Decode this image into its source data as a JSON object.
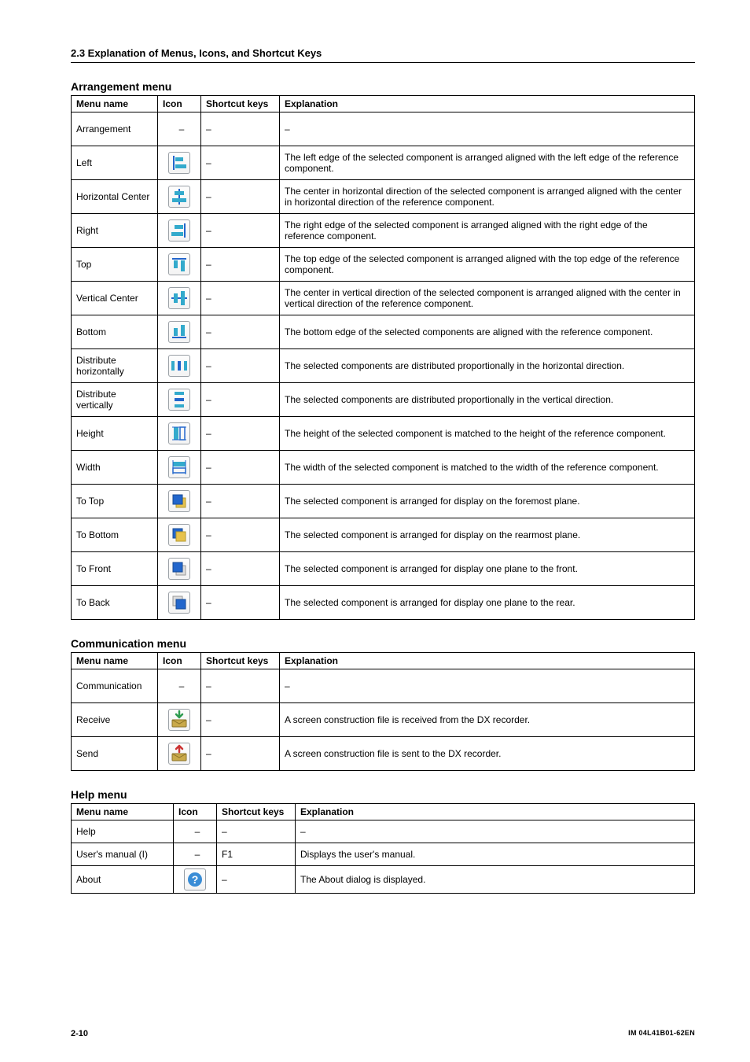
{
  "header": {
    "section": "2.3  Explanation of Menus, Icons, and Shortcut Keys"
  },
  "columns": {
    "name": "Menu name",
    "icon": "Icon",
    "shortcut": "Shortcut keys",
    "explanation": "Explanation"
  },
  "arrangement": {
    "title": "Arrangement menu",
    "rows": [
      {
        "name": "Arrangement",
        "icon": "none",
        "shortcut": "–",
        "explanation": "–"
      },
      {
        "name": "Left",
        "icon": "align-left",
        "shortcut": "–",
        "explanation": "The left edge of the selected component is arranged aligned with the left edge of the reference component."
      },
      {
        "name": "Horizontal Center",
        "icon": "align-hcenter",
        "shortcut": "–",
        "explanation": "The center in horizontal direction of the selected component is arranged aligned with the center in horizontal direction of the reference component."
      },
      {
        "name": "Right",
        "icon": "align-right",
        "shortcut": "–",
        "explanation": "The right edge of the selected component is arranged aligned with the right edge of the reference component."
      },
      {
        "name": "Top",
        "icon": "align-top",
        "shortcut": "–",
        "explanation": "The top edge of the selected component is arranged aligned with the top edge of the reference component."
      },
      {
        "name": "Vertical Center",
        "icon": "align-vcenter",
        "shortcut": "–",
        "explanation": "The center in vertical direction of the selected component is arranged aligned with the center in vertical direction of the reference component."
      },
      {
        "name": "Bottom",
        "icon": "align-bottom",
        "shortcut": "–",
        "explanation": "The bottom edge of the selected components are aligned with the reference component."
      },
      {
        "name": "Distribute horizontally",
        "icon": "dist-h",
        "shortcut": "–",
        "explanation": "The selected components are distributed proportionally in the horizontal direction."
      },
      {
        "name": "Distribute vertically",
        "icon": "dist-v",
        "shortcut": "–",
        "explanation": "The selected components are distributed proportionally in the vertical direction."
      },
      {
        "name": "Height",
        "icon": "match-height",
        "shortcut": "–",
        "explanation": "The height of the selected component is matched to the height of the reference component."
      },
      {
        "name": "Width",
        "icon": "match-width",
        "shortcut": "–",
        "explanation": "The width of the selected component is matched to the width of the reference component."
      },
      {
        "name": "To Top",
        "icon": "to-top",
        "shortcut": "–",
        "explanation": "The selected component is arranged for display on the foremost plane."
      },
      {
        "name": "To Bottom",
        "icon": "to-bottom",
        "shortcut": "–",
        "explanation": "The selected component is arranged for display on the rearmost plane."
      },
      {
        "name": "To Front",
        "icon": "to-front",
        "shortcut": "–",
        "explanation": "The selected component is arranged for display one plane to the front."
      },
      {
        "name": "To Back",
        "icon": "to-back",
        "shortcut": "–",
        "explanation": "The selected component is arranged for display one plane to the rear."
      }
    ]
  },
  "communication": {
    "title": "Communication menu",
    "rows": [
      {
        "name": "Communication",
        "icon": "none",
        "shortcut": "–",
        "explanation": "–"
      },
      {
        "name": "Receive",
        "icon": "receive",
        "shortcut": "–",
        "explanation": "A screen construction file is received from the DX recorder."
      },
      {
        "name": "Send",
        "icon": "send",
        "shortcut": "–",
        "explanation": "A screen construction file is sent to the DX recorder."
      }
    ]
  },
  "help": {
    "title": "Help menu",
    "rows": [
      {
        "name": "Help",
        "icon": "none",
        "shortcut": "–",
        "explanation": "–"
      },
      {
        "name": "User's manual (I)",
        "icon": "none",
        "shortcut": "F1",
        "explanation": "Displays the user's manual."
      },
      {
        "name": "About",
        "icon": "about",
        "shortcut": "–",
        "explanation": "The About dialog is displayed."
      }
    ]
  },
  "footer": {
    "page": "2-10",
    "doc": "IM 04L41B01-62EN"
  }
}
